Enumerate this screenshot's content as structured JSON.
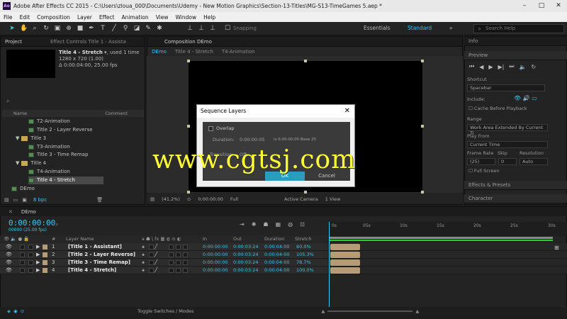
{
  "window": {
    "title": "Adobe After Effects CC 2015 - C:\\Users\\zloua_000\\Documents\\Udemy - New Motion Graphics\\Section-13-Titles\\MG-S13-TimeGames 5.aep *",
    "logo": "Ae"
  },
  "menu": [
    "File",
    "Edit",
    "Composition",
    "Layer",
    "Effect",
    "Animation",
    "View",
    "Window",
    "Help"
  ],
  "toolbar": {
    "snapping": "Snapping",
    "workspace_essentials": "Essentials",
    "workspace_standard": "Standard",
    "search_placeholder": "Search Help"
  },
  "project_panel": {
    "tab_project": "Project",
    "tab_effect_controls": "Effect Controls Title 1 - Assista",
    "selected_name": "Title 4 - Stretch",
    "used_count": ", used 1 time",
    "dimensions": "1280 x 720 (1.00)",
    "duration": "Δ 0:00:04:00, 25.00 fps",
    "col_name": "Name",
    "col_comment": "Comment",
    "items": [
      {
        "label": "T2-Animation",
        "type": "comp",
        "indent": 2
      },
      {
        "label": "Title 2 - Layer Reverse",
        "type": "comp",
        "indent": 2
      },
      {
        "label": "Title 3",
        "type": "folder",
        "indent": 1
      },
      {
        "label": "T3-Animation",
        "type": "comp",
        "indent": 2
      },
      {
        "label": "Title 3 - Time Remap",
        "type": "comp",
        "indent": 2
      },
      {
        "label": "Title 4",
        "type": "folder",
        "indent": 1
      },
      {
        "label": "T4-Animation",
        "type": "comp",
        "indent": 2
      },
      {
        "label": "Title 4 - Stretch",
        "type": "comp",
        "indent": 2,
        "selected": true
      },
      {
        "label": "DEmo",
        "type": "comp",
        "indent": 0
      }
    ],
    "bpc": "8 bpc"
  },
  "composition": {
    "tab_label": "Composition DEmo",
    "breadcrumbs": [
      "DEmo",
      "Title 4 - Stretch",
      "T4-Animation"
    ],
    "zoom": "(41.2%)",
    "timecode": "0:00:00:00",
    "resolution": "Full",
    "camera": "Active Camera",
    "views": "1 View"
  },
  "dialog": {
    "title": "Sequence Layers",
    "overlap_label": "Overlap",
    "duration_label": "Duration:",
    "duration_value": "0:00:00:05",
    "duration_info": "is 0:00:00:05  Base 25",
    "transition_label": "Transition:",
    "transition_value": "Off",
    "ok_label": "OK",
    "cancel_label": "Cancel"
  },
  "watermark": "www.cgtsj.com",
  "right_panel": {
    "info_tab": "Info",
    "preview_tab": "Preview",
    "shortcut_label": "Shortcut",
    "shortcut_value": "Spacebar",
    "include_label": "Include:",
    "cache_before_playback": "Cache Before Playback",
    "range_label": "Range",
    "range_value": "Work Area Extended By Current Ti",
    "play_from_label": "Play From",
    "play_from_value": "Current Time",
    "frame_rate_label": "Frame Rate",
    "skip_label": "Skip",
    "resolution_label": "Resolution",
    "frame_rate_value": "(25)",
    "skip_value": "0",
    "resolution_value": "Auto",
    "full_screen": "Full Screen",
    "effects_presets": "Effects & Presets",
    "character": "Character"
  },
  "timeline": {
    "tab_label": "DEmo",
    "timecode": "0:00:00:00",
    "fps": "00000 (25.00 fps)",
    "headers": {
      "num": "#",
      "layer_name": "Layer Name",
      "in": "In",
      "out": "Out",
      "duration": "Duration",
      "stretch": "Stretch"
    },
    "layers": [
      {
        "num": "1",
        "name": "[Title 1 - Assistant]",
        "in": "0:00:00:00",
        "out": "0:00:03:24",
        "duration": "0:00:04:00",
        "stretch": "80.0%"
      },
      {
        "num": "2",
        "name": "[Title 2 - Layer Reverse]",
        "in": "0:00:00:00",
        "out": "0:00:03:24",
        "duration": "0:00:04:00",
        "stretch": "105.3%"
      },
      {
        "num": "3",
        "name": "[Title 3 - Time Remap]",
        "in": "0:00:00:00",
        "out": "0:00:03:24",
        "duration": "0:00:04:00",
        "stretch": "78.7%"
      },
      {
        "num": "4",
        "name": "[Title 4 - Stretch]",
        "in": "0:00:00:00",
        "out": "0:00:03:24",
        "duration": "0:00:04:00",
        "stretch": "100.0%"
      }
    ],
    "ruler_ticks": [
      "0s",
      "05s",
      "10s",
      "15s",
      "20s",
      "25s",
      "30s"
    ],
    "toggle_label": "Toggle Switches / Modes"
  }
}
